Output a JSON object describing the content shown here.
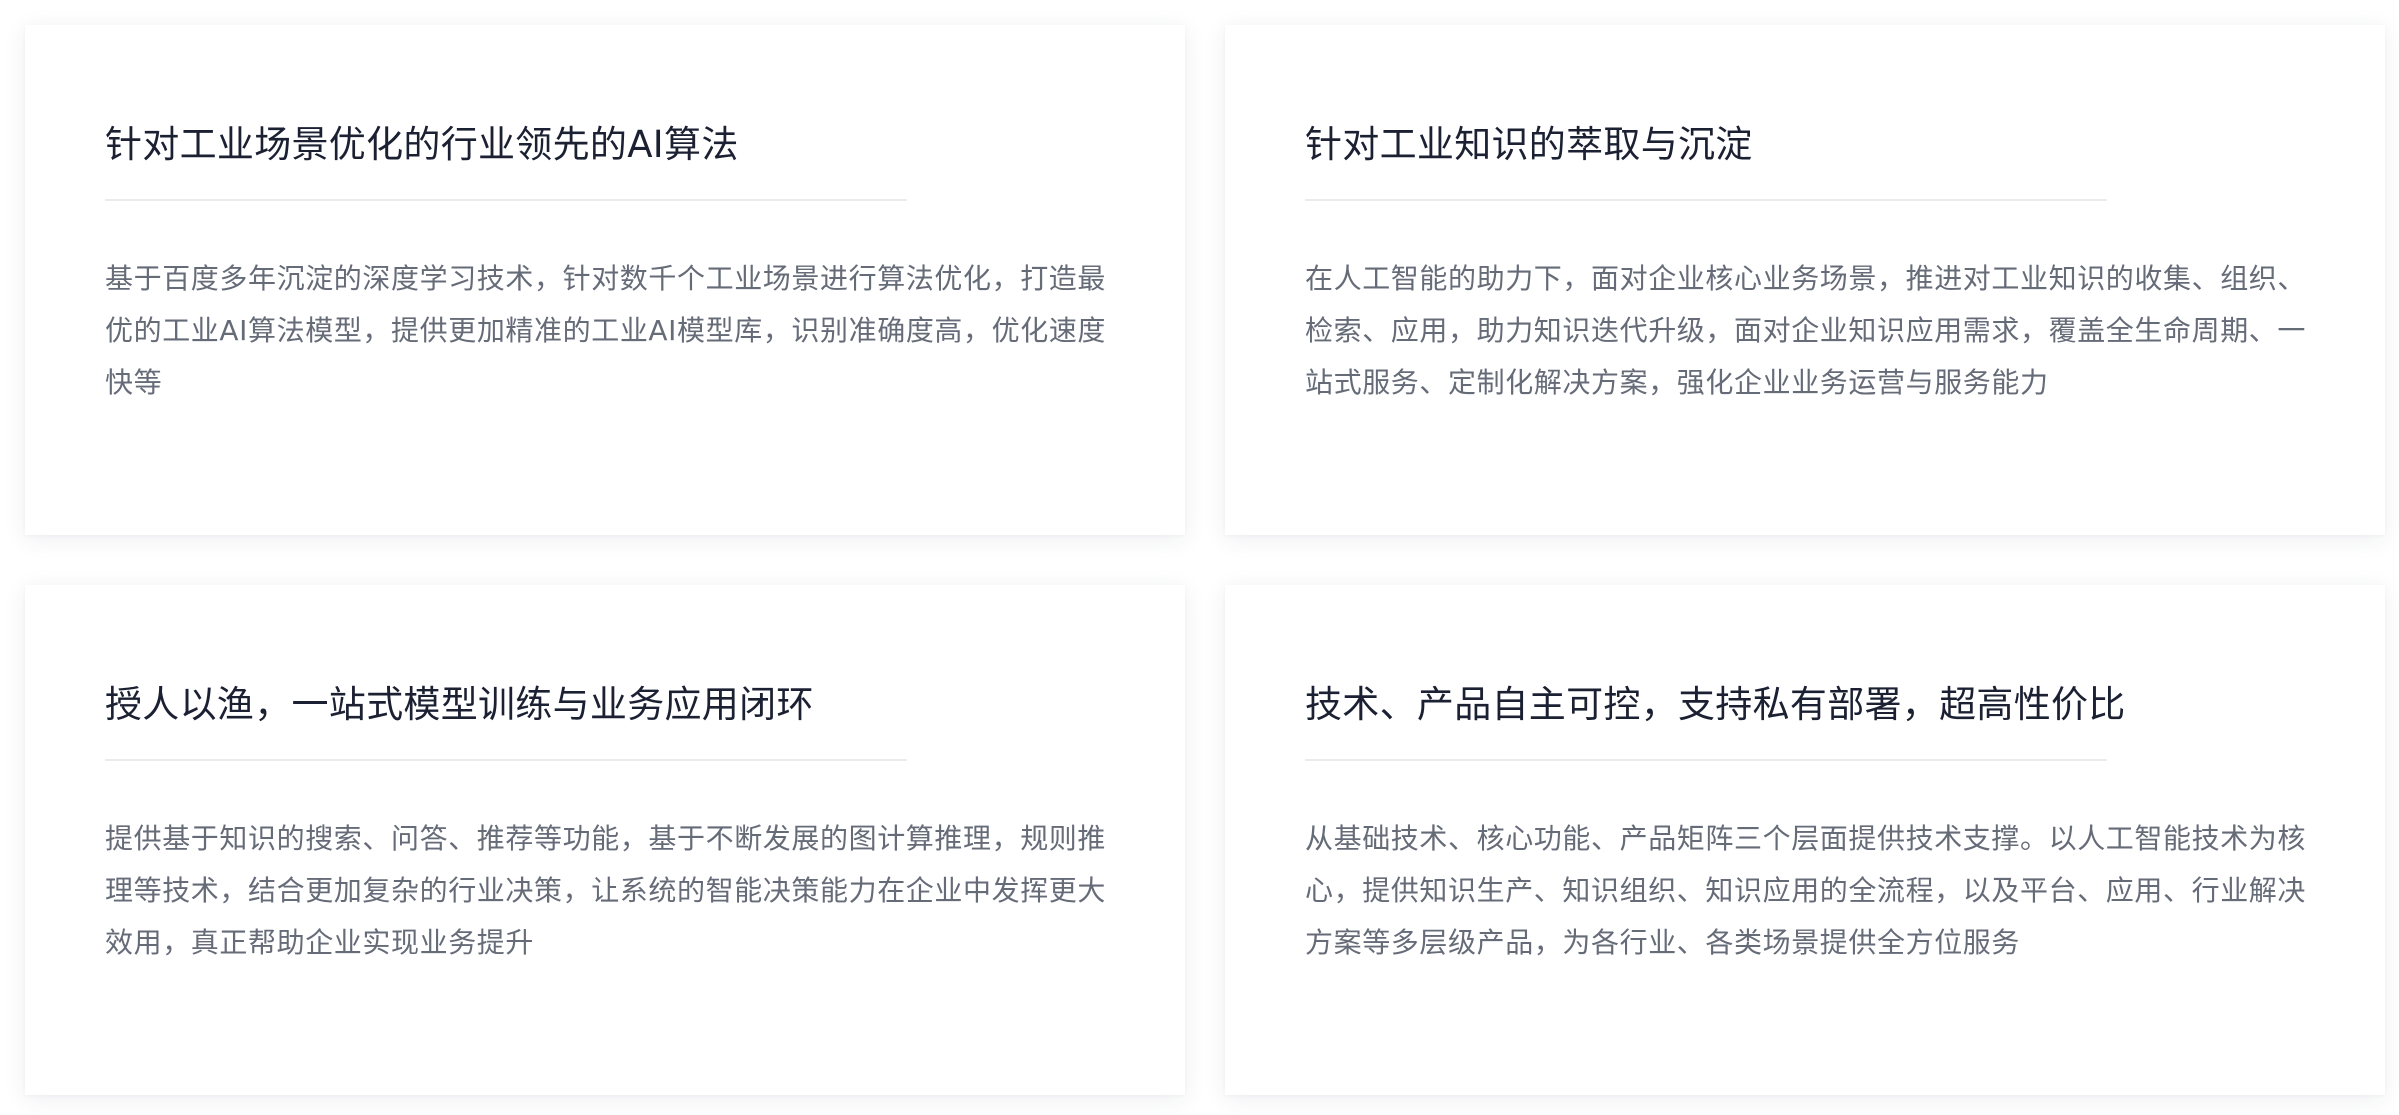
{
  "cards": [
    {
      "title": "针对工业场景优化的行业领先的AI算法",
      "description": "基于百度多年沉淀的深度学习技术，针对数千个工业场景进行算法优化，打造最优的工业AI算法模型，提供更加精准的工业AI模型库，识别准确度高，优化速度快等"
    },
    {
      "title": "针对工业知识的萃取与沉淀",
      "description": "在人工智能的助力下，面对企业核心业务场景，推进对工业知识的收集、组织、检索、应用，助力知识迭代升级，面对企业知识应用需求，覆盖全生命周期、一站式服务、定制化解决方案，强化企业业务运营与服务能力"
    },
    {
      "title": "授人以渔，一站式模型训练与业务应用闭环",
      "description": "提供基于知识的搜索、问答、推荐等功能，基于不断发展的图计算推理，规则推理等技术，结合更加复杂的行业决策，让系统的智能决策能力在企业中发挥更大效用，真正帮助企业实现业务提升"
    },
    {
      "title": "技术、产品自主可控，支持私有部署，超高性价比",
      "description": "从基础技术、核心功能、产品矩阵三个层面提供技术支撑。以人工智能技术为核心，提供知识生产、知识组织、知识应用的全流程，以及平台、应用、行业解决方案等多层级产品，为各行业、各类场景提供全方位服务"
    }
  ],
  "colors": {
    "title": "#1b2032",
    "description": "#666b78",
    "divider": "#e9ebef",
    "card_background": "#ffffff"
  }
}
